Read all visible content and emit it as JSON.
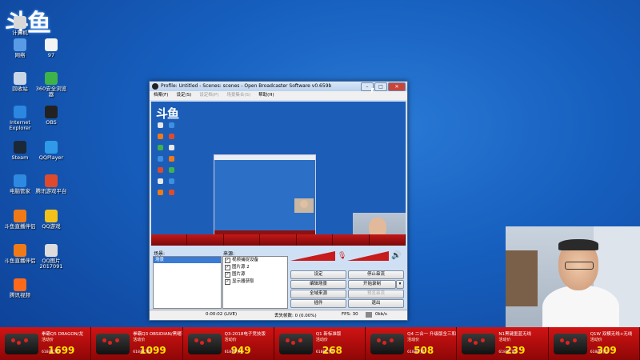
{
  "desktop": {
    "logo": "斗鱼",
    "icons": [
      {
        "label": "计算机",
        "icon": "computer-icon",
        "color": "#d8d8d8"
      },
      {
        "label": "网络",
        "icon": "network-icon",
        "color": "#5a9be6"
      },
      {
        "label": "97",
        "icon": "file-icon",
        "color": "#f4f4f4"
      },
      {
        "label": "回收站",
        "icon": "recycle-bin-icon",
        "color": "#c9d6e6"
      },
      {
        "label": "360安全浏览器",
        "icon": "browser-360-icon",
        "color": "#3eb34a"
      },
      {
        "label": "Internet Explorer",
        "icon": "ie-icon",
        "color": "#2c87e0"
      },
      {
        "label": "OBS",
        "icon": "obs-icon",
        "color": "#222222"
      },
      {
        "label": "Steam",
        "icon": "steam-icon",
        "color": "#1b2838"
      },
      {
        "label": "QQPlayer",
        "icon": "qqplayer-icon",
        "color": "#2f9be8"
      },
      {
        "label": "电脑管家",
        "icon": "pc-manager-icon",
        "color": "#2d8ae0"
      },
      {
        "label": "腾讯游戏平台",
        "icon": "tencent-game-icon",
        "color": "#e04a2c"
      },
      {
        "label": "斗鱼直播伴侣",
        "icon": "douyu-companion-icon",
        "color": "#f07a18"
      },
      {
        "label": "QQ游戏",
        "icon": "qq-game-icon",
        "color": "#f2c21b"
      },
      {
        "label": "斗鱼直播伴侣",
        "icon": "douyu-companion-icon",
        "color": "#f07a18"
      },
      {
        "label": "QQ图片 2017091",
        "icon": "image-icon",
        "color": "#dcdcdc"
      },
      {
        "label": "腾讯视频",
        "icon": "tencent-video-icon",
        "color": "#ff6a1a"
      }
    ]
  },
  "obs": {
    "title": "Profile: Untitled - Scenes: scenes - Open Broadcaster Software v0.659b",
    "window_buttons": [
      "–",
      "□",
      "✕"
    ],
    "menu": [
      "档案(F)",
      "设定(S)",
      "设定档(P)",
      "场景集合(S)",
      "帮助(H)"
    ],
    "scenes_label": "场景:",
    "scenes": [
      "场景"
    ],
    "sources_label": "来源:",
    "sources": [
      {
        "name": "视频捕捉设备",
        "checked": true
      },
      {
        "name": "图片源 2",
        "checked": true
      },
      {
        "name": "图片源",
        "checked": true
      },
      {
        "name": "显示器获取",
        "checked": true
      }
    ],
    "buttons": {
      "settings": "设定",
      "stop_stream": "停止串流",
      "edit_scene": "编辑场景",
      "start_record": "开始录制",
      "global_sources": "全域来源",
      "preview_stream": "预览串流",
      "plugins": "插件",
      "exit": "退出"
    },
    "status": {
      "time": "0:00:02 (LIVE)",
      "dropped": "丢失帧数: 0 (0.00%)",
      "fps": "FPS: 30",
      "kbps": "0kb/s"
    }
  },
  "preview_logo": "斗鱼",
  "banner": [
    {
      "name": "拳霸Q5 DRAGON/龙",
      "sub": "活动价",
      "price": "1699",
      "tag": "618开门红"
    },
    {
      "name": "拳霸Q3 OBSIDIAN/黑曜石",
      "sub": "活动价",
      "price": "1099",
      "tag": "618开门红"
    },
    {
      "name": "Q3-2018电子竞技版",
      "sub": "活动价",
      "price": "949",
      "tag": "618开门红"
    },
    {
      "name": "Q1 新标准版",
      "sub": "活动价",
      "price": "268",
      "tag": "618开门红"
    },
    {
      "name": "Q4 二合一 升级版全三和",
      "sub": "活动价",
      "price": "508",
      "tag": "618开门红"
    },
    {
      "name": "N1黑键墨蓝无线",
      "sub": "活动价",
      "price": "239",
      "tag": "618开门红"
    },
    {
      "name": "Q1W 双模无线+无线",
      "sub": "活动价",
      "price": "309",
      "tag": "618开门红"
    }
  ]
}
